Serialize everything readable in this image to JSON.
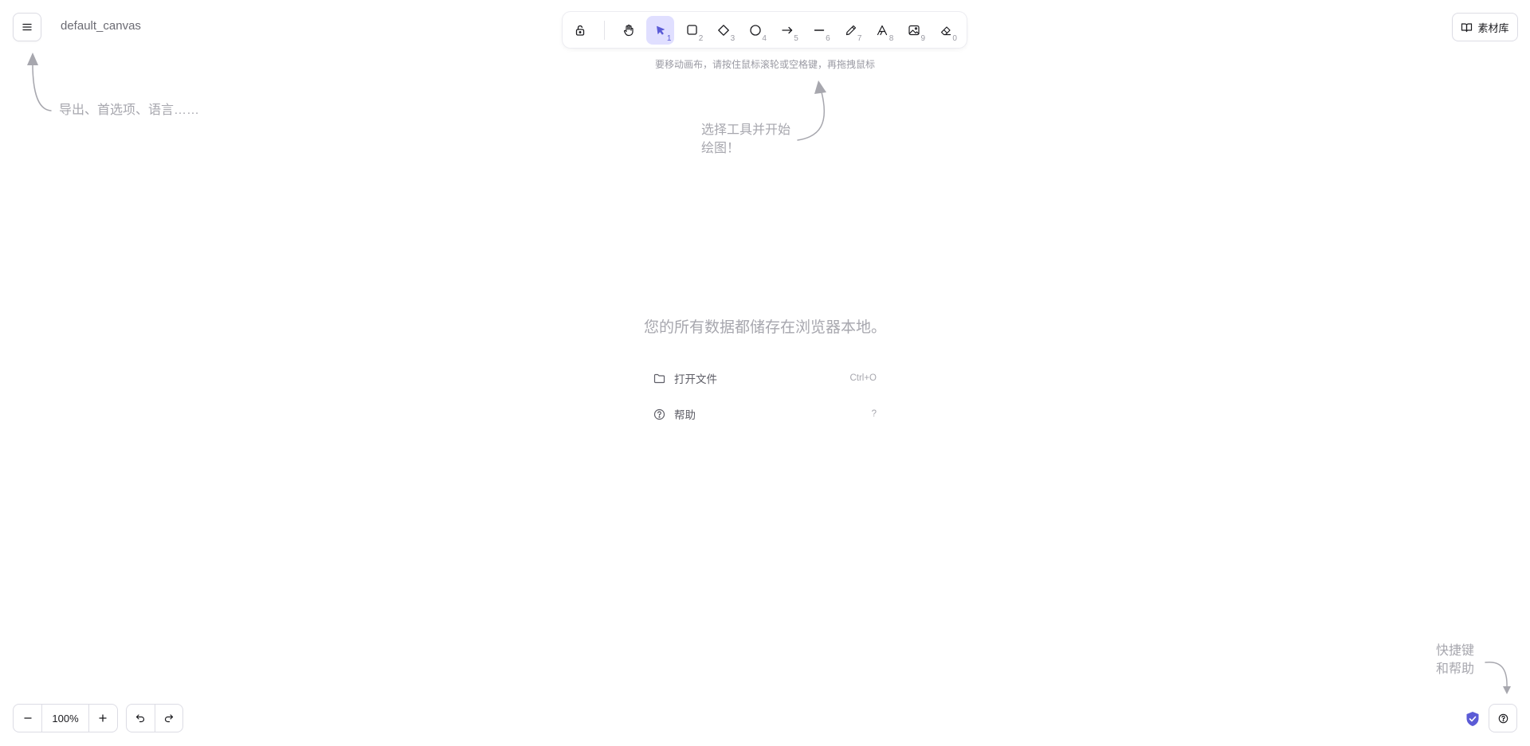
{
  "header": {
    "menu_icon": "hamburger-icon",
    "canvas_name": "default_canvas",
    "library_label": "素材库",
    "library_icon": "book-icon"
  },
  "toolbar": {
    "lock_icon": "lock-icon",
    "tools": [
      {
        "name": "hand",
        "icon": "hand-icon",
        "shortcut": ""
      },
      {
        "name": "selection",
        "icon": "pointer-icon",
        "shortcut": "1",
        "active": true
      },
      {
        "name": "rectangle",
        "icon": "square-icon",
        "shortcut": "2"
      },
      {
        "name": "diamond",
        "icon": "diamond-icon",
        "shortcut": "3"
      },
      {
        "name": "ellipse",
        "icon": "circle-icon",
        "shortcut": "4"
      },
      {
        "name": "arrow",
        "icon": "arrow-right-icon",
        "shortcut": "5"
      },
      {
        "name": "line",
        "icon": "line-icon",
        "shortcut": "6"
      },
      {
        "name": "draw",
        "icon": "pencil-icon",
        "shortcut": "7"
      },
      {
        "name": "text",
        "icon": "text-icon",
        "shortcut": "8"
      },
      {
        "name": "image",
        "icon": "image-icon",
        "shortcut": "9"
      },
      {
        "name": "eraser",
        "icon": "eraser-icon",
        "shortcut": "0"
      }
    ],
    "hint": "要移动画布，请按住鼠标滚轮或空格键，再拖拽鼠标",
    "accent_color": "#e0dfff",
    "accent_icon_color": "#5b5bd6"
  },
  "hints": {
    "menu_hint": "导出、首选项、语言……",
    "tool_hint_line1": "选择工具并开始",
    "tool_hint_line2": "绘图！",
    "help_hint_line1": "快捷键",
    "help_hint_line2": "和帮助"
  },
  "welcome": {
    "title": "您的所有数据都储存在浏览器本地。",
    "items": [
      {
        "label": "打开文件",
        "shortcut": "Ctrl+O",
        "icon": "folder-icon"
      },
      {
        "label": "帮助",
        "shortcut": "?",
        "icon": "question-circle-icon"
      }
    ]
  },
  "footer": {
    "zoom_out_icon": "minus-icon",
    "zoom_level": "100%",
    "zoom_in_icon": "plus-icon",
    "undo_icon": "undo-icon",
    "redo_icon": "redo-icon",
    "shield_icon": "shield-check-icon",
    "help_icon": "question-circle-icon",
    "shield_color": "#5b5bd6"
  }
}
